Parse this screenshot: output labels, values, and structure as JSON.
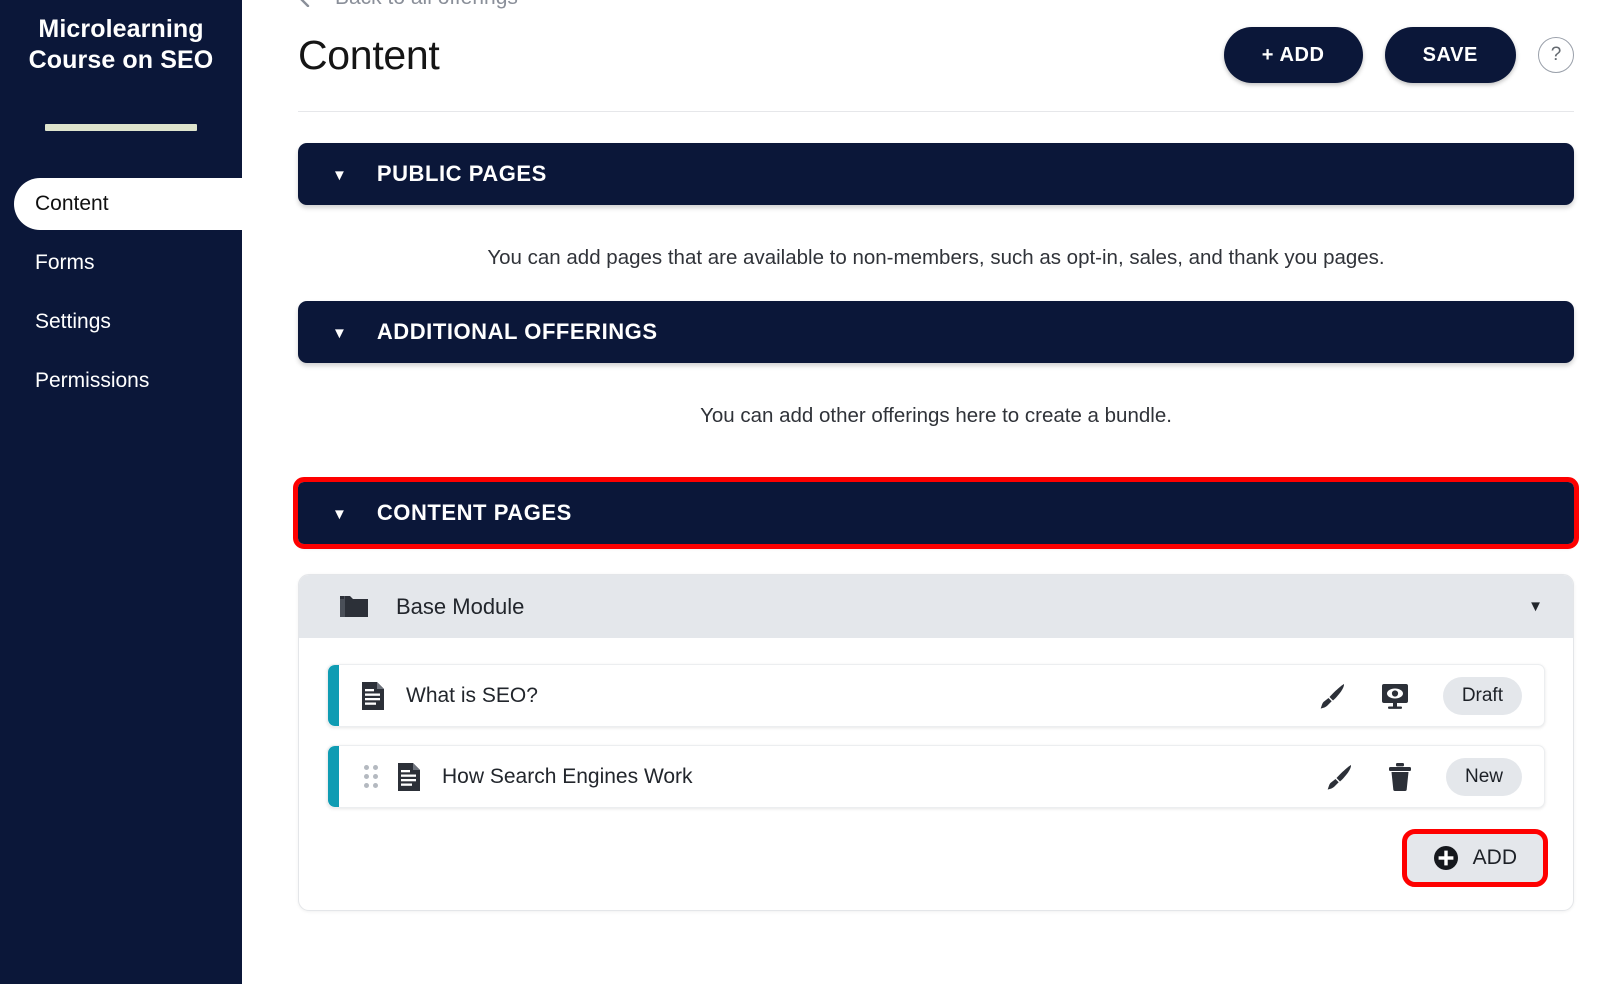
{
  "sidebar": {
    "brand": "Microlearning Course on SEO",
    "items": [
      {
        "label": "Content",
        "active": true
      },
      {
        "label": "Forms",
        "active": false
      },
      {
        "label": "Settings",
        "active": false
      },
      {
        "label": "Permissions",
        "active": false
      }
    ]
  },
  "header": {
    "back_link": "Back to all offerings",
    "back_icon": "arrow-left-icon",
    "title": "Content",
    "add_label": "+ ADD",
    "save_label": "SAVE",
    "help_label": "?"
  },
  "sections": [
    {
      "key": "public_pages",
      "caret": "▼",
      "title": "PUBLIC PAGES",
      "description": "You can add pages that are available to non-members, such as opt-in, sales, and thank you pages.",
      "highlighted": false
    },
    {
      "key": "additional_offerings",
      "caret": "▼",
      "title": "ADDITIONAL OFFERINGS",
      "description": "You can add other offerings here to create a bundle.",
      "highlighted": false
    },
    {
      "key": "content_pages",
      "caret": "▼",
      "title": "CONTENT PAGES",
      "description": "",
      "highlighted": true
    }
  ],
  "module": {
    "folder_icon": "folder-icon",
    "name": "Base Module",
    "caret": "▼",
    "pages": [
      {
        "drag_handle": false,
        "doc_icon": "document-icon",
        "title": "What is SEO?",
        "actions": [
          "paintbrush-icon",
          "preview-monitor-icon"
        ],
        "status": "Draft"
      },
      {
        "drag_handle": true,
        "doc_icon": "document-icon",
        "title": "How Search Engines Work",
        "actions": [
          "paintbrush-icon",
          "trash-icon"
        ],
        "status": "New"
      }
    ],
    "add_label": "ADD",
    "add_icon": "plus-circle-icon",
    "add_highlighted": true
  },
  "colors": {
    "navy": "#0b1739",
    "teal_accent": "#0f9cb3",
    "divider_cream": "#dee4cd",
    "highlight_red": "#fe0000",
    "badge_grey": "#e4e7eb"
  }
}
